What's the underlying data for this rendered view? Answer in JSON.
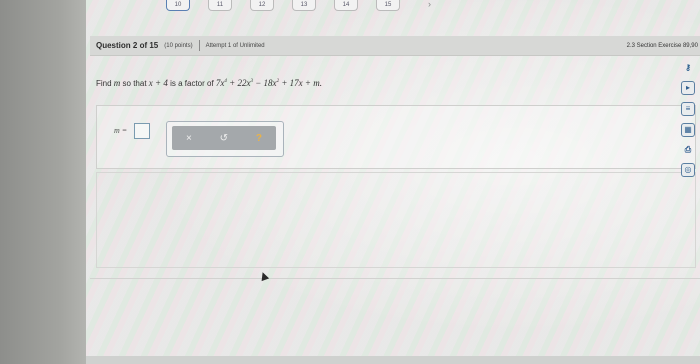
{
  "nav": {
    "items": [
      "10",
      "11",
      "12",
      "13",
      "14",
      "15"
    ],
    "active_index": 0,
    "next_symbol": "›"
  },
  "header": {
    "title": "Question 2 of 15",
    "points": "(10 points)",
    "attempt": "Attempt 1 of Unlimited",
    "section": "2.3 Section Exercise 89,90"
  },
  "question": {
    "prefix": "Find",
    "var_m": "m",
    "middle": "so that",
    "factor": "x + 4",
    "suffix": "is a factor of",
    "poly": {
      "c1": "7x",
      "e1": "4",
      "c2": " + 22x",
      "e2": "3",
      "c3": " − 18x",
      "e3": "2",
      "c4": " + 17x + m."
    }
  },
  "answer": {
    "label": "m =",
    "value": ""
  },
  "tools": {
    "clear": "×",
    "undo": "↺",
    "help": "?"
  },
  "sidebar": [
    "key-icon",
    "play-icon",
    "textbook-icon",
    "calculator-icon",
    "print-icon",
    "settings-icon"
  ]
}
